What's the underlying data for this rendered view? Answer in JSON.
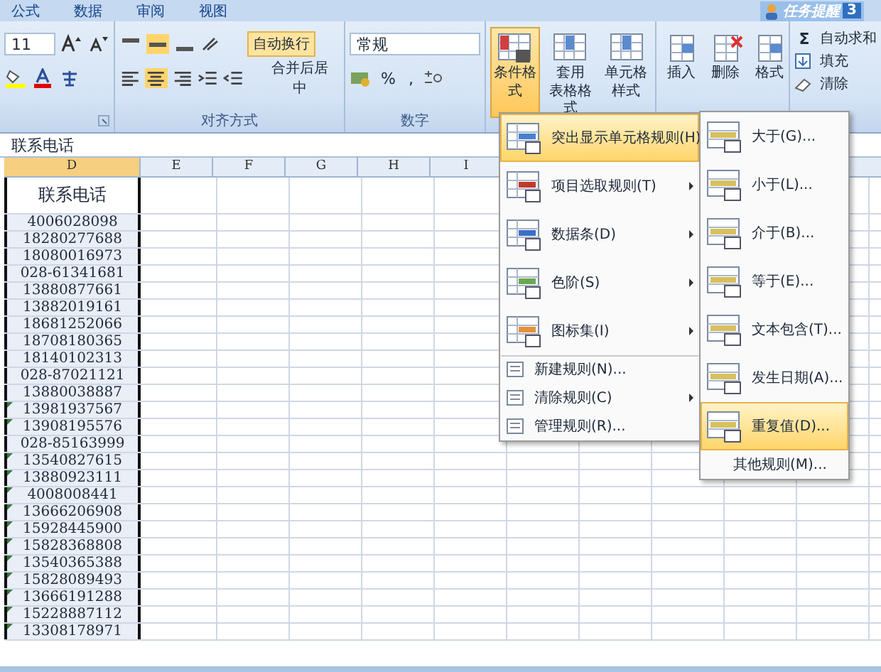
{
  "menu_tabs": [
    {
      "label": "公式"
    },
    {
      "label": "数据"
    },
    {
      "label": "审阅"
    },
    {
      "label": "视图"
    }
  ],
  "notice": {
    "label": "任务提醒",
    "count": "3"
  },
  "ribbon": {
    "font": {
      "size": "11"
    },
    "alignment": {
      "wrap_text": {
        "label": "自动换行",
        "on": true
      },
      "merge": {
        "label": "合并后居中"
      },
      "group_label": "对齐方式"
    },
    "number": {
      "format": "常规",
      "percent": "%",
      "comma": ",",
      "group_label": "数字"
    },
    "styles": [
      {
        "lines": [
          "条件格式"
        ],
        "selected": true
      },
      {
        "lines": [
          "套用",
          "表格格式"
        ],
        "selected": false
      },
      {
        "lines": [
          "单元格",
          "样式"
        ],
        "selected": false
      }
    ],
    "cells": [
      {
        "label": "插入"
      },
      {
        "label": "删除"
      },
      {
        "label": "格式"
      }
    ],
    "editing": [
      {
        "label": "自动求和",
        "symbol": "Σ"
      },
      {
        "label": "填充"
      },
      {
        "label": "清除"
      }
    ]
  },
  "formula_bar": {
    "value": "联系电话"
  },
  "columns": [
    {
      "label": "D",
      "selected": true
    },
    {
      "label": "E",
      "selected": false
    },
    {
      "label": "F",
      "selected": false
    },
    {
      "label": "G",
      "selected": false
    },
    {
      "label": "H",
      "selected": false
    },
    {
      "label": "I",
      "selected": false
    }
  ],
  "column_d": {
    "header": "联系电话",
    "cells": [
      {
        "value": "4006028098",
        "flagged": false
      },
      {
        "value": "18280277688",
        "flagged": false
      },
      {
        "value": "18080016973",
        "flagged": false
      },
      {
        "value": "028-61341681",
        "flagged": false
      },
      {
        "value": "13880877661",
        "flagged": false
      },
      {
        "value": "13882019161",
        "flagged": false
      },
      {
        "value": "18681252066",
        "flagged": false
      },
      {
        "value": "18708180365",
        "flagged": false
      },
      {
        "value": "18140102313",
        "flagged": false
      },
      {
        "value": "028-87021121",
        "flagged": false
      },
      {
        "value": "13880038887",
        "flagged": false
      },
      {
        "value": "13981937567",
        "flagged": true
      },
      {
        "value": "13908195576",
        "flagged": true
      },
      {
        "value": "028-85163999",
        "flagged": false
      },
      {
        "value": "13540827615",
        "flagged": true
      },
      {
        "value": "13880923111",
        "flagged": true
      },
      {
        "value": "4008008441",
        "flagged": true
      },
      {
        "value": "13666206908",
        "flagged": true
      },
      {
        "value": "15928445900",
        "flagged": true
      },
      {
        "value": "15828368808",
        "flagged": true
      },
      {
        "value": "13540365388",
        "flagged": true
      },
      {
        "value": "15828089493",
        "flagged": true
      },
      {
        "value": "13666191288",
        "flagged": true
      },
      {
        "value": "15228887112",
        "flagged": true
      },
      {
        "value": "13308178971",
        "flagged": true
      }
    ]
  },
  "conditional_menu": {
    "items": [
      {
        "kind": "large",
        "label": "突出显示单元格规则(H)",
        "submenu": true,
        "selected": true
      },
      {
        "kind": "large",
        "label": "项目选取规则(T)",
        "submenu": true,
        "selected": false
      },
      {
        "kind": "large",
        "label": "数据条(D)",
        "submenu": true,
        "selected": false
      },
      {
        "kind": "large",
        "label": "色阶(S)",
        "submenu": true,
        "selected": false
      },
      {
        "kind": "large",
        "label": "图标集(I)",
        "submenu": true,
        "selected": false
      },
      {
        "kind": "small",
        "label": "新建规则(N)...",
        "submenu": false,
        "selected": false
      },
      {
        "kind": "small",
        "label": "清除规则(C)",
        "submenu": true,
        "selected": false
      },
      {
        "kind": "small",
        "label": "管理规则(R)...",
        "submenu": false,
        "selected": false
      }
    ]
  },
  "highlight_submenu": {
    "items": [
      {
        "kind": "large",
        "label": "大于(G)...",
        "selected": false
      },
      {
        "kind": "large",
        "label": "小于(L)...",
        "selected": false
      },
      {
        "kind": "large",
        "label": "介于(B)...",
        "selected": false
      },
      {
        "kind": "large",
        "label": "等于(E)...",
        "selected": false
      },
      {
        "kind": "large",
        "label": "文本包含(T)...",
        "selected": false
      },
      {
        "kind": "large",
        "label": "发生日期(A)...",
        "selected": false
      },
      {
        "kind": "large",
        "label": "重复值(D)...",
        "selected": true
      },
      {
        "kind": "small",
        "label": "其他规则(M)...",
        "selected": false
      }
    ]
  }
}
